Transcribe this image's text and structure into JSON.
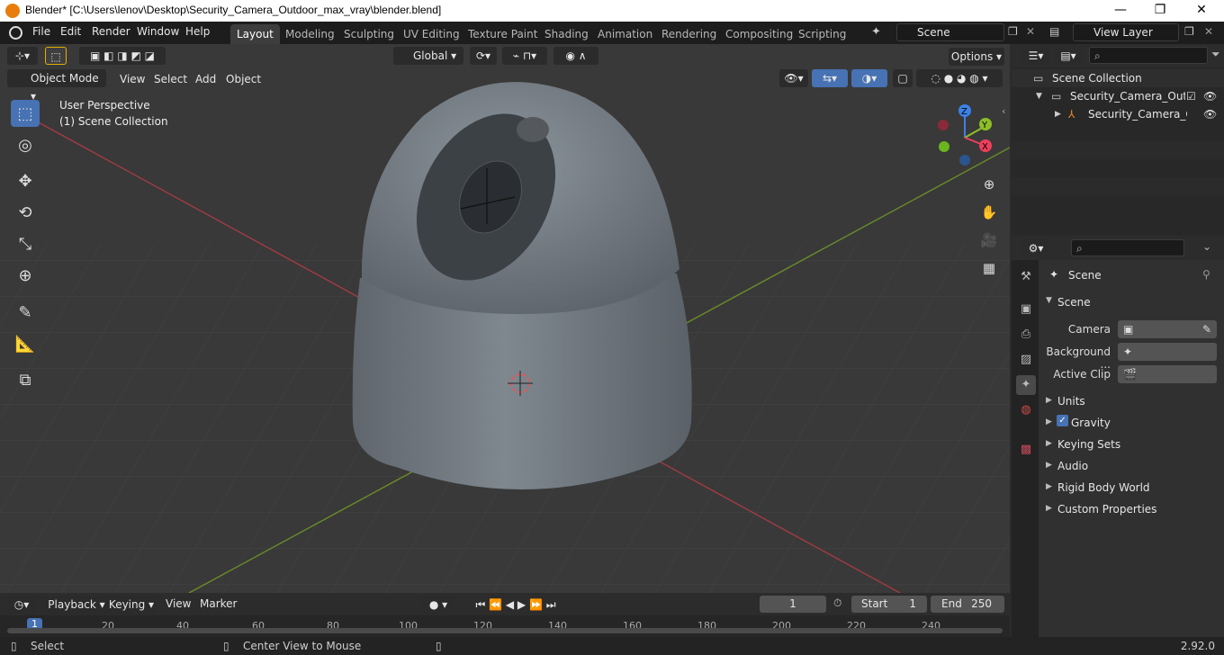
{
  "window": {
    "title": "Blender* [C:\\Users\\lenov\\Desktop\\Security_Camera_Outdoor_max_vray\\blender.blend]",
    "minimize": "—",
    "maximize": "❐",
    "close": "✕"
  },
  "menu": [
    "File",
    "Edit",
    "Render",
    "Window",
    "Help"
  ],
  "workspaces": [
    "Layout",
    "Modeling",
    "Sculpting",
    "UV Editing",
    "Texture Paint",
    "Shading",
    "Animation",
    "Rendering",
    "Compositing",
    "Scripting"
  ],
  "scene_field": "Scene",
  "view_layer_field": "View Layer",
  "viewport": {
    "transform_orientation": "Global",
    "options": "Options",
    "mode": "Object Mode",
    "menus": [
      "View",
      "Select",
      "Add",
      "Object"
    ],
    "info_line1": "User Perspective",
    "info_line2": "(1) Scene Collection",
    "gizmo": {
      "x": "X",
      "y": "Y",
      "z": "Z"
    }
  },
  "outliner": {
    "root": "Scene Collection",
    "collection": "Security_Camera_Outdoo",
    "object": "Security_Camera_Ou"
  },
  "properties": {
    "context": "Scene",
    "panel": "Scene",
    "camera_label": "Camera",
    "background_label": "Background ...",
    "active_clip_label": "Active Clip",
    "subpanels": [
      "Units",
      "Gravity",
      "Keying Sets",
      "Audio",
      "Rigid Body World",
      "Custom Properties"
    ]
  },
  "timeline": {
    "menus": [
      "Playback",
      "Keying",
      "View",
      "Marker"
    ],
    "current_frame": "1",
    "start_label": "Start",
    "start_value": "1",
    "end_label": "End",
    "end_value": "250",
    "ruler_ticks": [
      "1",
      "20",
      "40",
      "60",
      "80",
      "100",
      "120",
      "140",
      "160",
      "180",
      "200",
      "220",
      "240"
    ]
  },
  "status": {
    "left": "Select",
    "middle": "Center View to Mouse",
    "version": "2.92.0"
  },
  "colors": {
    "accent": "#4772b3",
    "x_axis": "#ee3f5a",
    "y_axis": "#8cbf26",
    "z_axis": "#3b82e8",
    "header": "#1d1d1d"
  }
}
